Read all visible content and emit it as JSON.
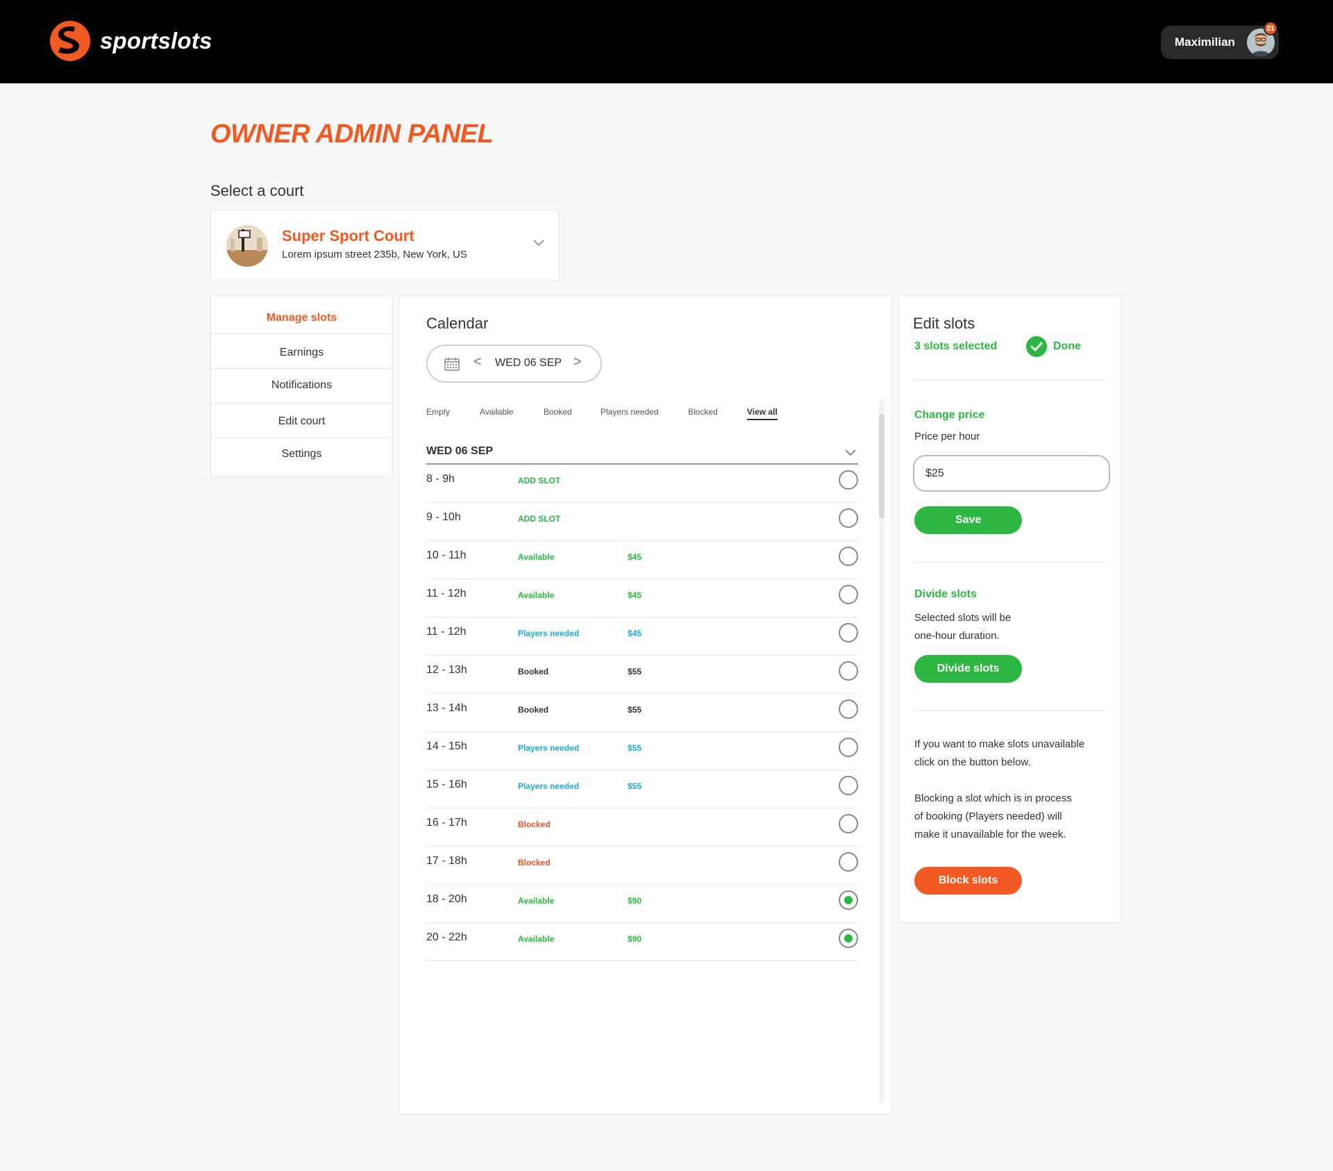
{
  "header": {
    "brand": "sportslots",
    "user_name": "Maximilian",
    "notification_count": "21",
    "colors": {
      "brand": "#f15a22",
      "bar": "#000000"
    }
  },
  "page": {
    "title": "OWNER ADMIN PANEL",
    "select_court_label": "Select a court"
  },
  "court": {
    "name": "Super Sport Court",
    "address": "Lorem ipsum street  235b, New York, US"
  },
  "nav": {
    "items": [
      {
        "label": "Manage slots",
        "active": true
      },
      {
        "label": "Earnings",
        "active": false
      },
      {
        "label": "Notifications",
        "active": false
      },
      {
        "label": "Edit court",
        "active": false
      },
      {
        "label": "Settings",
        "active": false
      }
    ]
  },
  "calendar": {
    "title": "Calendar",
    "date": "WED 06 SEP",
    "prev": "<",
    "next": ">",
    "filters": [
      "Empty",
      "Available",
      "Booked",
      "Players needed",
      "Blocked",
      "View all"
    ],
    "active_filter": "View all",
    "day_title": "WED 06 SEP",
    "slots": [
      {
        "time": "8 - 9h",
        "status": "ADD SLOT",
        "type": "add",
        "price": "",
        "selected": false
      },
      {
        "time": "9 - 10h",
        "status": "ADD SLOT",
        "type": "add",
        "price": "",
        "selected": false
      },
      {
        "time": "10 - 11h",
        "status": "Available",
        "type": "available",
        "price": "$45",
        "selected": false
      },
      {
        "time": "11 - 12h",
        "status": "Available",
        "type": "available",
        "price": "$45",
        "selected": false
      },
      {
        "time": "11 - 12h",
        "status": "Players needed",
        "type": "players",
        "price": "$45",
        "selected": false
      },
      {
        "time": "12 - 13h",
        "status": "Booked",
        "type": "booked",
        "price": "$55",
        "selected": false
      },
      {
        "time": "13 - 14h",
        "status": "Booked",
        "type": "booked",
        "price": "$55",
        "selected": false
      },
      {
        "time": "14 - 15h",
        "status": "Players needed",
        "type": "players",
        "price": "$55",
        "selected": false
      },
      {
        "time": "15 - 16h",
        "status": "Players needed",
        "type": "players",
        "price": "$55",
        "selected": false
      },
      {
        "time": "16 - 17h",
        "status": "Blocked",
        "type": "blocked",
        "price": "",
        "selected": false
      },
      {
        "time": "17 - 18h",
        "status": "Blocked",
        "type": "blocked",
        "price": "",
        "selected": false
      },
      {
        "time": "18 - 20h",
        "status": "Available",
        "type": "available",
        "price": "$90",
        "selected": true
      },
      {
        "time": "20 - 22h",
        "status": "Available",
        "type": "available",
        "price": "$90",
        "selected": true
      }
    ]
  },
  "edit": {
    "title": "Edit slots",
    "selected_text": "3 slots selected",
    "done_label": "Done",
    "change_price_title": "Change price",
    "price_label": "Price per hour",
    "price_value": "$25",
    "save_label": "Save",
    "divide_title": "Divide slots",
    "divide_text_1": "Selected slots will be",
    "divide_text_2": "one-hour duration.",
    "divide_button": "Divide slots",
    "block_text_1": "If you want to make slots unavailable",
    "block_text_2": "click on the button below.",
    "block_text_3": "Blocking a slot which is in process",
    "block_text_4": "of booking (Players needed) will",
    "block_text_5": "make it unavailable for the week.",
    "block_button": "Block slots"
  },
  "status_colors": {
    "available": "#2db742",
    "players_needed": "#1ea8d8",
    "booked": "#333333",
    "blocked": "#e8532a"
  }
}
